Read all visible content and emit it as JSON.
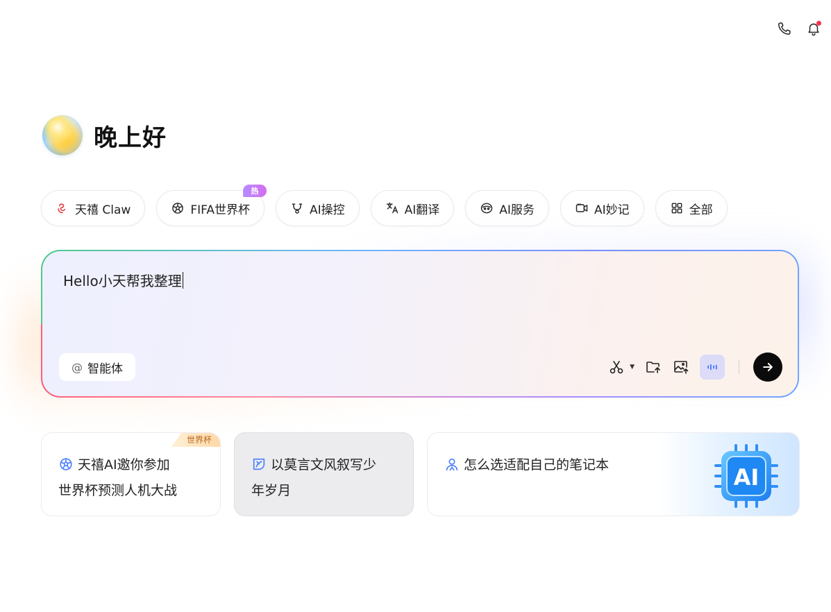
{
  "greeting": "晚上好",
  "chips": [
    {
      "label": "天禧 Claw",
      "icon": "claw-icon"
    },
    {
      "label": "FIFA世界杯",
      "icon": "soccer-ball-icon",
      "badge": "热"
    },
    {
      "label": "AI操控",
      "icon": "robot-icon"
    },
    {
      "label": "AI翻译",
      "icon": "translate-icon"
    },
    {
      "label": "AI服务",
      "icon": "service-icon"
    },
    {
      "label": "AI妙记",
      "icon": "video-note-icon"
    },
    {
      "label": "全部",
      "icon": "grid-icon"
    }
  ],
  "input": {
    "value": "Hello小天帮我整理"
  },
  "agent_button": {
    "at": "@",
    "label": "智能体"
  },
  "cards": [
    {
      "line1": "天禧AI邀你参加",
      "line2": "世界杯预测人机大战",
      "tag": "世界杯",
      "icon": "soccer-ball-icon"
    },
    {
      "line1": "以莫言文风叙写少",
      "line2": "年岁月",
      "icon": "leaf-icon"
    },
    {
      "line1": "怎么选适配自己的笔记本",
      "line2": "",
      "icon": "person-icon",
      "art_text": "AI"
    }
  ],
  "colors": {
    "accent": "#3b6cff",
    "badge": "#c27cf5",
    "send": "#0b0b0b"
  }
}
